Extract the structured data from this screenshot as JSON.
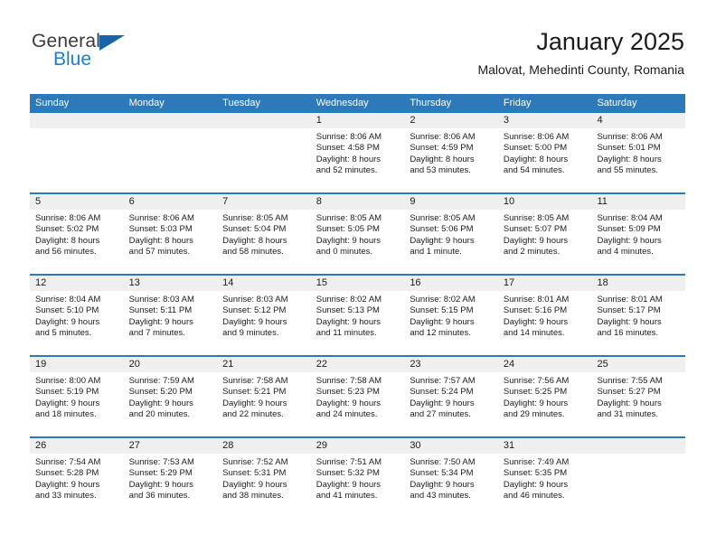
{
  "brand": {
    "name_part1": "General",
    "name_part2": "Blue",
    "accent_color": "#1565a8",
    "blue_text_color": "#1a7fd4"
  },
  "header": {
    "title": "January 2025",
    "subtitle": "Malovat, Mehedinti County, Romania"
  },
  "theme": {
    "header_blue": "#2e79b9",
    "daynum_band": "#efefef",
    "text": "#1c1c1c"
  },
  "weekday_headers": [
    "Sunday",
    "Monday",
    "Tuesday",
    "Wednesday",
    "Thursday",
    "Friday",
    "Saturday"
  ],
  "weeks": [
    [
      {
        "day": "",
        "sunrise": "",
        "sunset": "",
        "daylight1": "",
        "daylight2": ""
      },
      {
        "day": "",
        "sunrise": "",
        "sunset": "",
        "daylight1": "",
        "daylight2": ""
      },
      {
        "day": "",
        "sunrise": "",
        "sunset": "",
        "daylight1": "",
        "daylight2": ""
      },
      {
        "day": "1",
        "sunrise": "Sunrise: 8:06 AM",
        "sunset": "Sunset: 4:58 PM",
        "daylight1": "Daylight: 8 hours",
        "daylight2": "and 52 minutes."
      },
      {
        "day": "2",
        "sunrise": "Sunrise: 8:06 AM",
        "sunset": "Sunset: 4:59 PM",
        "daylight1": "Daylight: 8 hours",
        "daylight2": "and 53 minutes."
      },
      {
        "day": "3",
        "sunrise": "Sunrise: 8:06 AM",
        "sunset": "Sunset: 5:00 PM",
        "daylight1": "Daylight: 8 hours",
        "daylight2": "and 54 minutes."
      },
      {
        "day": "4",
        "sunrise": "Sunrise: 8:06 AM",
        "sunset": "Sunset: 5:01 PM",
        "daylight1": "Daylight: 8 hours",
        "daylight2": "and 55 minutes."
      }
    ],
    [
      {
        "day": "5",
        "sunrise": "Sunrise: 8:06 AM",
        "sunset": "Sunset: 5:02 PM",
        "daylight1": "Daylight: 8 hours",
        "daylight2": "and 56 minutes."
      },
      {
        "day": "6",
        "sunrise": "Sunrise: 8:06 AM",
        "sunset": "Sunset: 5:03 PM",
        "daylight1": "Daylight: 8 hours",
        "daylight2": "and 57 minutes."
      },
      {
        "day": "7",
        "sunrise": "Sunrise: 8:05 AM",
        "sunset": "Sunset: 5:04 PM",
        "daylight1": "Daylight: 8 hours",
        "daylight2": "and 58 minutes."
      },
      {
        "day": "8",
        "sunrise": "Sunrise: 8:05 AM",
        "sunset": "Sunset: 5:05 PM",
        "daylight1": "Daylight: 9 hours",
        "daylight2": "and 0 minutes."
      },
      {
        "day": "9",
        "sunrise": "Sunrise: 8:05 AM",
        "sunset": "Sunset: 5:06 PM",
        "daylight1": "Daylight: 9 hours",
        "daylight2": "and 1 minute."
      },
      {
        "day": "10",
        "sunrise": "Sunrise: 8:05 AM",
        "sunset": "Sunset: 5:07 PM",
        "daylight1": "Daylight: 9 hours",
        "daylight2": "and 2 minutes."
      },
      {
        "day": "11",
        "sunrise": "Sunrise: 8:04 AM",
        "sunset": "Sunset: 5:09 PM",
        "daylight1": "Daylight: 9 hours",
        "daylight2": "and 4 minutes."
      }
    ],
    [
      {
        "day": "12",
        "sunrise": "Sunrise: 8:04 AM",
        "sunset": "Sunset: 5:10 PM",
        "daylight1": "Daylight: 9 hours",
        "daylight2": "and 5 minutes."
      },
      {
        "day": "13",
        "sunrise": "Sunrise: 8:03 AM",
        "sunset": "Sunset: 5:11 PM",
        "daylight1": "Daylight: 9 hours",
        "daylight2": "and 7 minutes."
      },
      {
        "day": "14",
        "sunrise": "Sunrise: 8:03 AM",
        "sunset": "Sunset: 5:12 PM",
        "daylight1": "Daylight: 9 hours",
        "daylight2": "and 9 minutes."
      },
      {
        "day": "15",
        "sunrise": "Sunrise: 8:02 AM",
        "sunset": "Sunset: 5:13 PM",
        "daylight1": "Daylight: 9 hours",
        "daylight2": "and 11 minutes."
      },
      {
        "day": "16",
        "sunrise": "Sunrise: 8:02 AM",
        "sunset": "Sunset: 5:15 PM",
        "daylight1": "Daylight: 9 hours",
        "daylight2": "and 12 minutes."
      },
      {
        "day": "17",
        "sunrise": "Sunrise: 8:01 AM",
        "sunset": "Sunset: 5:16 PM",
        "daylight1": "Daylight: 9 hours",
        "daylight2": "and 14 minutes."
      },
      {
        "day": "18",
        "sunrise": "Sunrise: 8:01 AM",
        "sunset": "Sunset: 5:17 PM",
        "daylight1": "Daylight: 9 hours",
        "daylight2": "and 16 minutes."
      }
    ],
    [
      {
        "day": "19",
        "sunrise": "Sunrise: 8:00 AM",
        "sunset": "Sunset: 5:19 PM",
        "daylight1": "Daylight: 9 hours",
        "daylight2": "and 18 minutes."
      },
      {
        "day": "20",
        "sunrise": "Sunrise: 7:59 AM",
        "sunset": "Sunset: 5:20 PM",
        "daylight1": "Daylight: 9 hours",
        "daylight2": "and 20 minutes."
      },
      {
        "day": "21",
        "sunrise": "Sunrise: 7:58 AM",
        "sunset": "Sunset: 5:21 PM",
        "daylight1": "Daylight: 9 hours",
        "daylight2": "and 22 minutes."
      },
      {
        "day": "22",
        "sunrise": "Sunrise: 7:58 AM",
        "sunset": "Sunset: 5:23 PM",
        "daylight1": "Daylight: 9 hours",
        "daylight2": "and 24 minutes."
      },
      {
        "day": "23",
        "sunrise": "Sunrise: 7:57 AM",
        "sunset": "Sunset: 5:24 PM",
        "daylight1": "Daylight: 9 hours",
        "daylight2": "and 27 minutes."
      },
      {
        "day": "24",
        "sunrise": "Sunrise: 7:56 AM",
        "sunset": "Sunset: 5:25 PM",
        "daylight1": "Daylight: 9 hours",
        "daylight2": "and 29 minutes."
      },
      {
        "day": "25",
        "sunrise": "Sunrise: 7:55 AM",
        "sunset": "Sunset: 5:27 PM",
        "daylight1": "Daylight: 9 hours",
        "daylight2": "and 31 minutes."
      }
    ],
    [
      {
        "day": "26",
        "sunrise": "Sunrise: 7:54 AM",
        "sunset": "Sunset: 5:28 PM",
        "daylight1": "Daylight: 9 hours",
        "daylight2": "and 33 minutes."
      },
      {
        "day": "27",
        "sunrise": "Sunrise: 7:53 AM",
        "sunset": "Sunset: 5:29 PM",
        "daylight1": "Daylight: 9 hours",
        "daylight2": "and 36 minutes."
      },
      {
        "day": "28",
        "sunrise": "Sunrise: 7:52 AM",
        "sunset": "Sunset: 5:31 PM",
        "daylight1": "Daylight: 9 hours",
        "daylight2": "and 38 minutes."
      },
      {
        "day": "29",
        "sunrise": "Sunrise: 7:51 AM",
        "sunset": "Sunset: 5:32 PM",
        "daylight1": "Daylight: 9 hours",
        "daylight2": "and 41 minutes."
      },
      {
        "day": "30",
        "sunrise": "Sunrise: 7:50 AM",
        "sunset": "Sunset: 5:34 PM",
        "daylight1": "Daylight: 9 hours",
        "daylight2": "and 43 minutes."
      },
      {
        "day": "31",
        "sunrise": "Sunrise: 7:49 AM",
        "sunset": "Sunset: 5:35 PM",
        "daylight1": "Daylight: 9 hours",
        "daylight2": "and 46 minutes."
      },
      {
        "day": "",
        "sunrise": "",
        "sunset": "",
        "daylight1": "",
        "daylight2": ""
      }
    ]
  ]
}
